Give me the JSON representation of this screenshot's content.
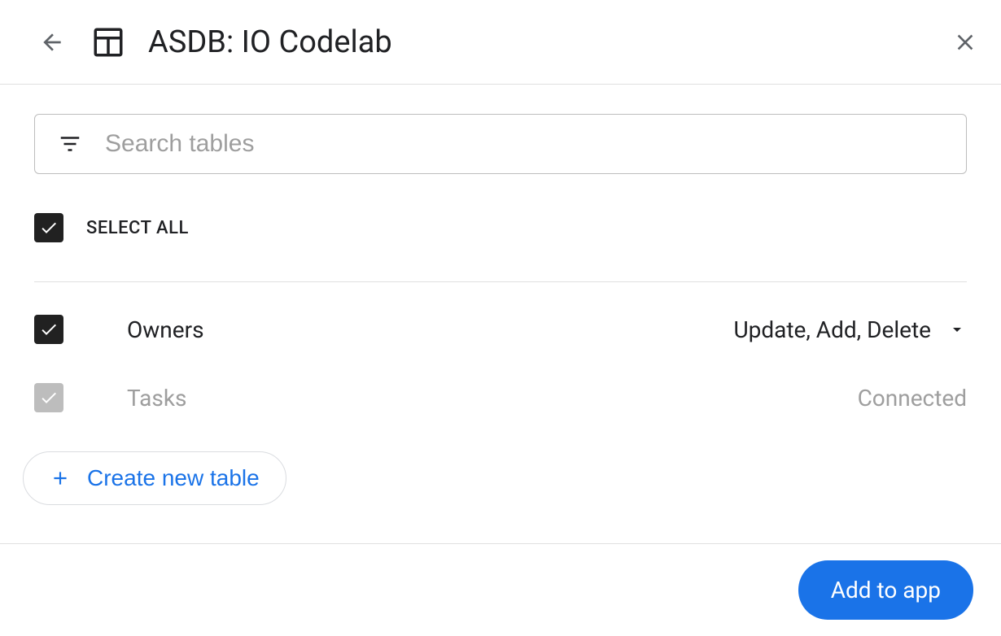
{
  "header": {
    "title": "ASDB: IO Codelab"
  },
  "search": {
    "placeholder": "Search tables"
  },
  "selectAll": {
    "label": "SELECT ALL"
  },
  "tables": [
    {
      "name": "Owners",
      "permissions": "Update, Add, Delete",
      "checked": true,
      "disabled": false
    },
    {
      "name": "Tasks",
      "status": "Connected",
      "checked": true,
      "disabled": true
    }
  ],
  "actions": {
    "createTable": "Create new table",
    "addToApp": "Add to app"
  }
}
